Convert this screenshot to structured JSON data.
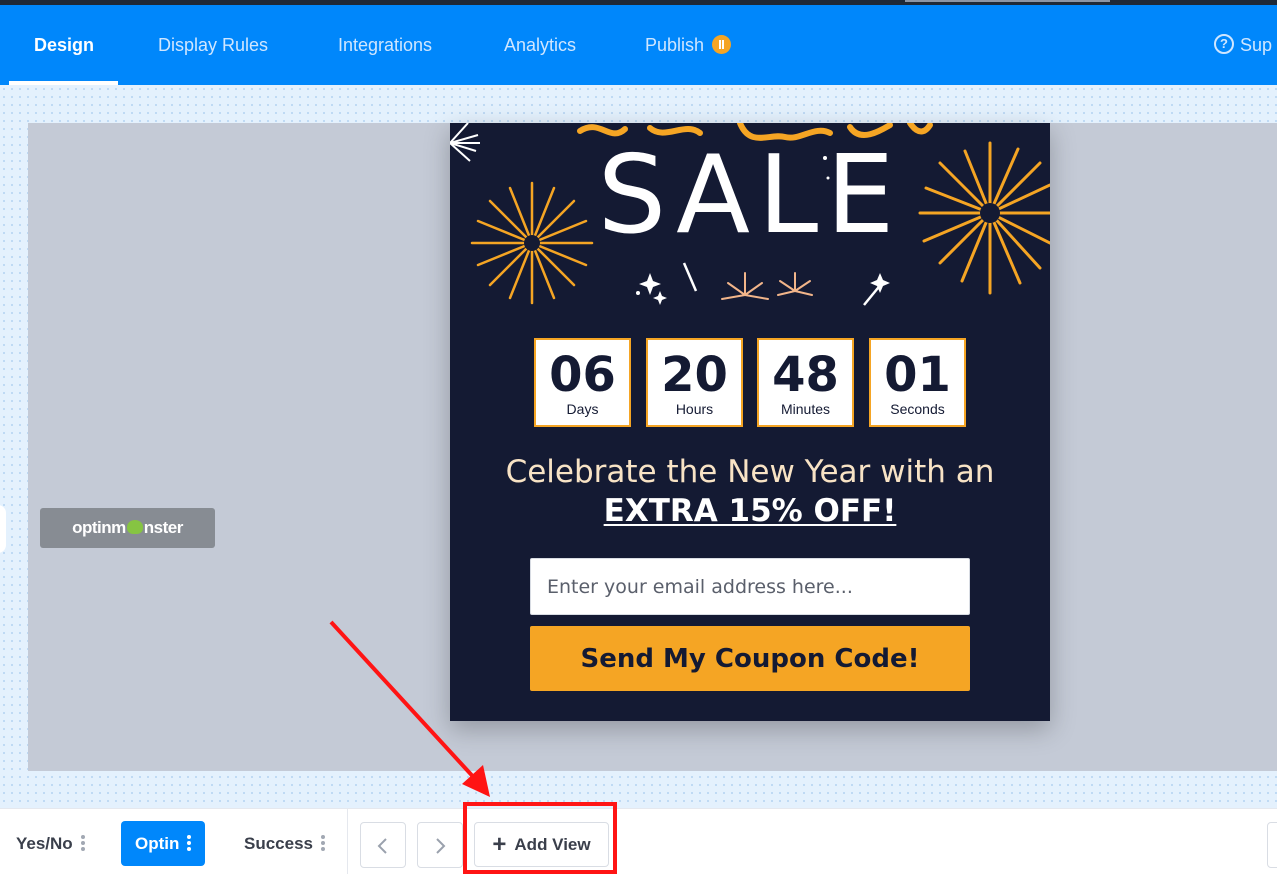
{
  "nav": {
    "tabs": [
      {
        "label": "Design",
        "active": true
      },
      {
        "label": "Display Rules"
      },
      {
        "label": "Integrations"
      },
      {
        "label": "Analytics"
      },
      {
        "label": "Publish",
        "badge_icon": "pause-icon"
      }
    ],
    "support_label": "Sup"
  },
  "canvas": {
    "logo_text": "optinmonster"
  },
  "popup": {
    "title": "SALE",
    "countdown": [
      {
        "value": "06",
        "label": "Days"
      },
      {
        "value": "20",
        "label": "Hours"
      },
      {
        "value": "48",
        "label": "Minutes"
      },
      {
        "value": "01",
        "label": "Seconds"
      }
    ],
    "headline_prefix": "Celebrate the New Year with an ",
    "headline_highlight": "EXTRA 15% OFF!",
    "email_placeholder": "Enter your email address here...",
    "cta_label": "Send My Coupon Code!"
  },
  "views": {
    "tabs": [
      {
        "label": "Yes/No"
      },
      {
        "label": "Optin",
        "active": true
      },
      {
        "label": "Success"
      }
    ],
    "prev_icon": "chevron-left-icon",
    "next_icon": "chevron-right-icon",
    "add_view_label": "Add View"
  },
  "colors": {
    "nav_blue": "#0087fb",
    "popup_bg": "#141a33",
    "accent_gold": "#f5a524",
    "annotation_red": "#ff1414"
  }
}
